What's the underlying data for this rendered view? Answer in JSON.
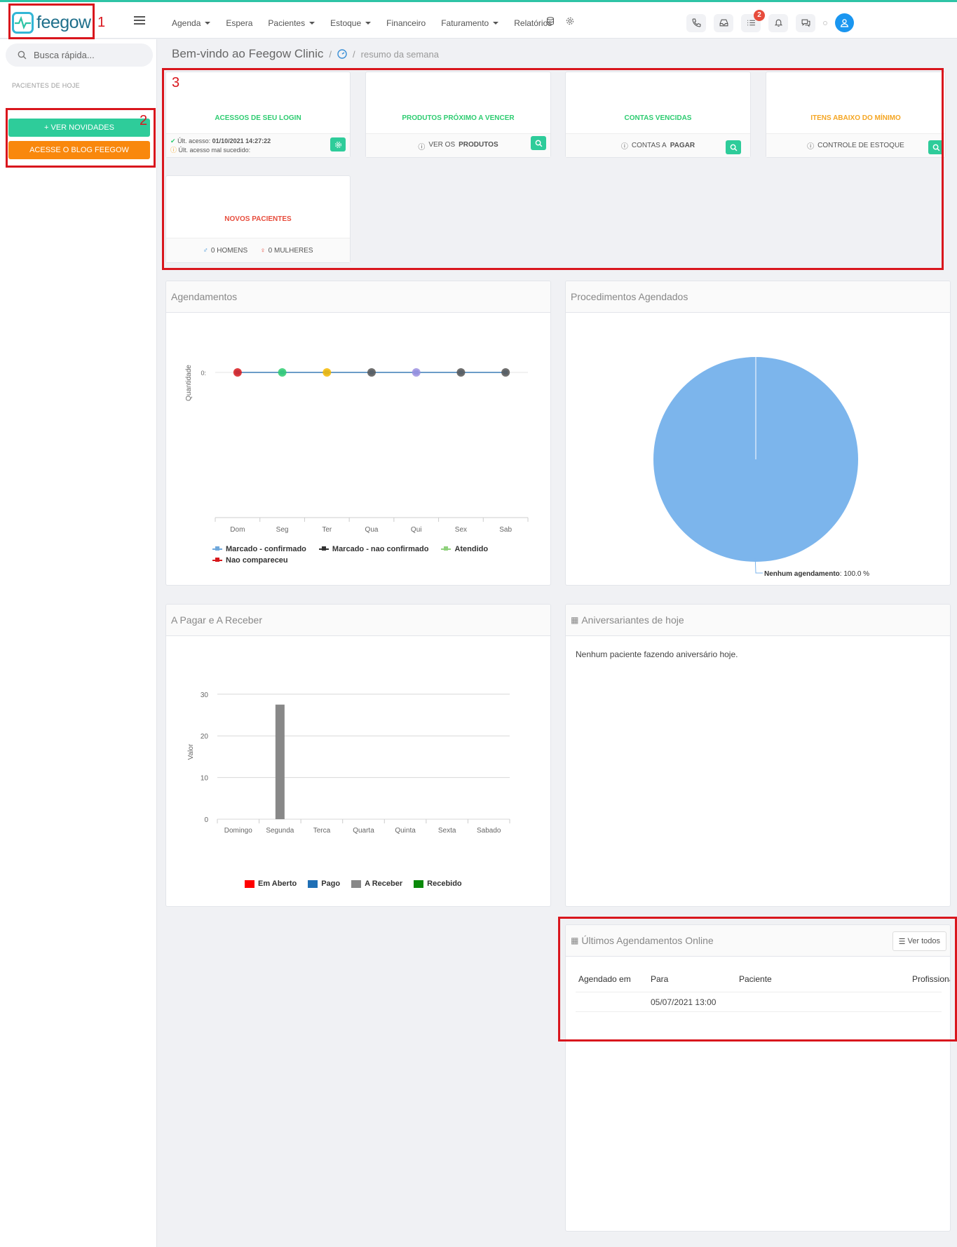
{
  "brand": {
    "name": "feegow",
    "markers": {
      "logo": "1",
      "sidebar_buttons": "2",
      "cards": "3"
    }
  },
  "nav": {
    "items": [
      "Agenda",
      "Espera",
      "Pacientes",
      "Estoque",
      "Financeiro",
      "Faturamento",
      "Relatórios"
    ],
    "with_caret": [
      true,
      false,
      true,
      true,
      false,
      true,
      false
    ]
  },
  "header": {
    "notifications_count": "2"
  },
  "sidebar": {
    "search_placeholder": "Busca rápida...",
    "section_label": "PACIENTES DE HOJE",
    "btn_novidades": "VER NOVIDADES",
    "btn_blog": "ACESSE O BLOG FEEGOW"
  },
  "breadcrumb": {
    "title": "Bem-vindo ao Feegow Clinic",
    "separator": "/",
    "current": "resumo da semana"
  },
  "cards": {
    "login": {
      "title": "ACESSOS DE SEU LOGIN",
      "color": "#2ecc71",
      "last_access_label": "Últ. acesso:",
      "last_access_value": "01/10/2021 14:27:22",
      "failed_label": "Últ. acesso mal sucedido:"
    },
    "produtos": {
      "title": "PRODUTOS PRÓXIMO A VENCER",
      "color": "#2ecc71",
      "foot_a": "VER OS",
      "foot_b": "PRODUTOS"
    },
    "contas": {
      "title": "CONTAS VENCIDAS",
      "color": "#2ecc71",
      "foot_a": "CONTAS A",
      "foot_b": "PAGAR"
    },
    "itens": {
      "title": "ITENS ABAIXO DO MÍNIMO",
      "color": "#f5a623",
      "foot": "CONTROLE DE ESTOQUE"
    },
    "novos": {
      "title": "NOVOS PACIENTES",
      "color": "#e74c3c",
      "men": "0 HOMENS",
      "women": "0 MULHERES"
    }
  },
  "panels": {
    "agendamentos": "Agendamentos",
    "procedimentos": "Procedimentos Agendados",
    "pagar_receber": "A Pagar e A Receber",
    "aniversariantes": "Aniversariantes de hoje",
    "aniversariantes_empty": "Nenhum paciente fazendo aniversário hoje.",
    "ultimos": "Últimos Agendamentos Online",
    "ver_todos": "Ver todos"
  },
  "chart_data": [
    {
      "type": "line",
      "title": "Agendamentos",
      "ylabel": "Quantidade",
      "categories": [
        "Dom",
        "Seg",
        "Ter",
        "Qua",
        "Qui",
        "Sex",
        "Sab"
      ],
      "y_tick": "0",
      "series": [
        {
          "name": "Marcado - confirmado",
          "values": [
            0,
            0,
            0,
            0,
            0,
            0,
            0
          ],
          "color": "#6fa8dc"
        },
        {
          "name": "Marcado - nao confirmado",
          "values": [
            0,
            0,
            0,
            0,
            0,
            0,
            0
          ],
          "color": "#333333"
        },
        {
          "name": "Atendido",
          "values": [
            0,
            0,
            0,
            0,
            0,
            0,
            0
          ],
          "color": "#8fd17c"
        },
        {
          "name": "Nao compareceu",
          "values": [
            0,
            0,
            0,
            0,
            0,
            0,
            0
          ],
          "color": "#d7191c"
        }
      ]
    },
    {
      "type": "pie",
      "title": "Procedimentos Agendados",
      "slices": [
        {
          "name": "Nenhum agendamento",
          "value": 100.0,
          "label": "100.0 %",
          "color": "#7cb5ec"
        }
      ]
    },
    {
      "type": "bar",
      "title": "A Pagar e A Receber",
      "ylabel": "Valor",
      "ylim": [
        0,
        30
      ],
      "yticks": [
        0,
        10,
        20,
        30
      ],
      "categories": [
        "Domingo",
        "Segunda",
        "Terca",
        "Quarta",
        "Quinta",
        "Sexta",
        "Sabado"
      ],
      "series": [
        {
          "name": "Em Aberto",
          "values": [
            0,
            0,
            0,
            0,
            0,
            0,
            0
          ],
          "color": "#ff0000"
        },
        {
          "name": "Pago",
          "values": [
            0,
            0,
            0,
            0,
            0,
            0,
            0
          ],
          "color": "#1f6fb5"
        },
        {
          "name": "A Receber",
          "values": [
            0,
            27.5,
            0,
            0,
            0,
            0,
            0
          ],
          "color": "#888888"
        },
        {
          "name": "Recebido",
          "values": [
            0,
            0,
            0,
            0,
            0,
            0,
            0
          ],
          "color": "#0a8a0a"
        }
      ]
    }
  ],
  "table": {
    "headers": [
      "Agendado em",
      "Para",
      "Paciente",
      "Profissional"
    ],
    "rows": [
      [
        "",
        "05/07/2021 13:00",
        "",
        ""
      ]
    ]
  }
}
